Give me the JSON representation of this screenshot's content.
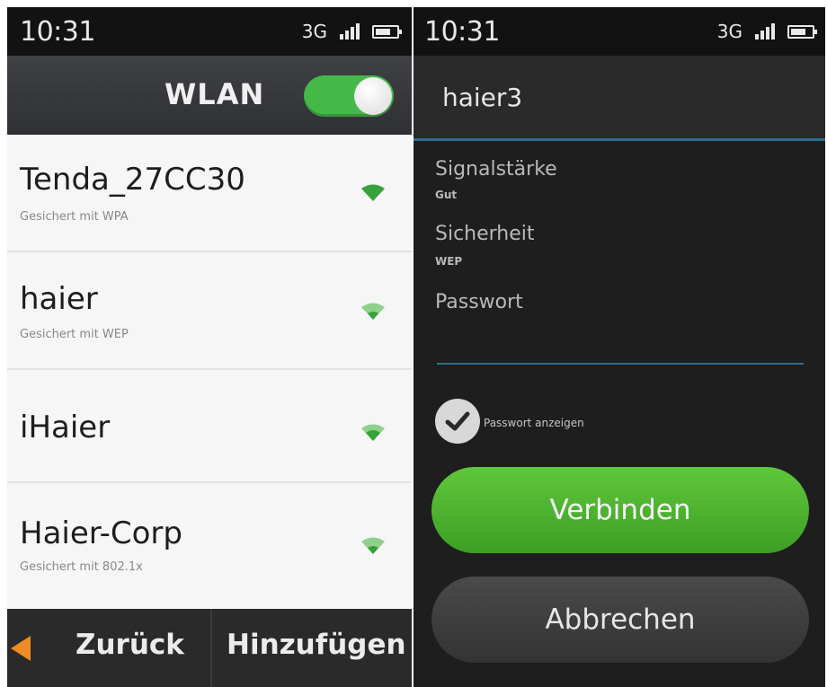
{
  "colors": {
    "accent_green": "#46b84a",
    "wifi_green": "#36a33a",
    "back_arrow_orange": "#ee8b22",
    "input_underline_blue": "#2c6f92"
  },
  "left_screen": {
    "status_bar": {
      "time": "10:31",
      "network": "3G"
    },
    "header": {
      "title": "WLAN",
      "toggle_on": true
    },
    "networks": [
      {
        "name": "Tenda_27CC30",
        "subtitle": "Gesichert mit WPA",
        "icon": "wifi-signal-icon"
      },
      {
        "name": "haier",
        "subtitle": "Gesichert mit WEP",
        "icon": "wifi-signal-icon"
      },
      {
        "name": "iHaier",
        "subtitle": "",
        "icon": "wifi-signal-icon"
      },
      {
        "name": "Haier-Corp",
        "subtitle": "Gesichert mit 802.1x",
        "icon": "wifi-signal-icon"
      }
    ],
    "bottom": {
      "back_label": "Zurück",
      "add_label": "Hinzufügen"
    }
  },
  "right_screen": {
    "status_bar": {
      "time": "10:31",
      "network": "3G"
    },
    "dialog": {
      "title": "haier3",
      "signal_label": "Signalstärke",
      "signal_value": "Gut",
      "security_label": "Sicherheit",
      "security_value": "WEP",
      "password_label": "Passwort",
      "password_value": "",
      "show_password_label": "Passwort anzeigen",
      "show_password_checked": true,
      "connect_label": "Verbinden",
      "cancel_label": "Abbrechen"
    }
  }
}
